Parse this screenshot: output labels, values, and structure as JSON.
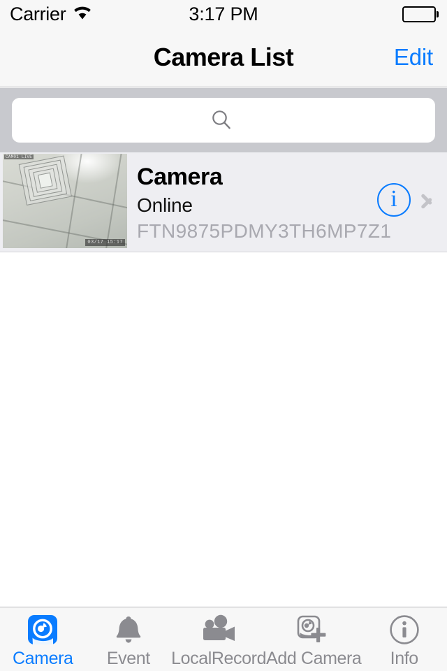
{
  "statusbar": {
    "carrier": "Carrier",
    "wifi_icon": "wifi-icon",
    "time": "3:17 PM",
    "battery_icon": "battery-full-icon"
  },
  "navbar": {
    "title": "Camera List",
    "edit_label": "Edit"
  },
  "search": {
    "icon": "search-icon",
    "value": "",
    "placeholder": ""
  },
  "cameras": [
    {
      "name": "Camera",
      "status": "Online",
      "serial": "FTN9875PDMY3TH6MP7Z1",
      "thumbnail_osd_topleft": "CAM01 LIVE",
      "thumbnail_osd_bottomright": "03/17 15:17",
      "thumbnail_subject": "ceiling-vent-thumbnail",
      "info_icon": "info-circle-icon",
      "disclosure_icon": "chevron-right-icon"
    }
  ],
  "tabbar": {
    "items": [
      {
        "label": "Camera",
        "icon": "camera-lens-icon",
        "active": true
      },
      {
        "label": "Event",
        "icon": "bell-icon",
        "active": false
      },
      {
        "label": "LocalRecord",
        "icon": "movie-camera-icon",
        "active": false
      },
      {
        "label": "Add Camera",
        "icon": "camera-plus-icon",
        "active": false
      },
      {
        "label": "Info",
        "icon": "info-circle-icon",
        "active": false
      }
    ]
  },
  "colors": {
    "accent": "#0a7cff",
    "chrome": "#f7f7f7",
    "search_band": "#c8c9ce",
    "row_background": "#eeeef2",
    "inactive_tab": "#8b8b90",
    "serial_text": "#a9a9b0"
  }
}
